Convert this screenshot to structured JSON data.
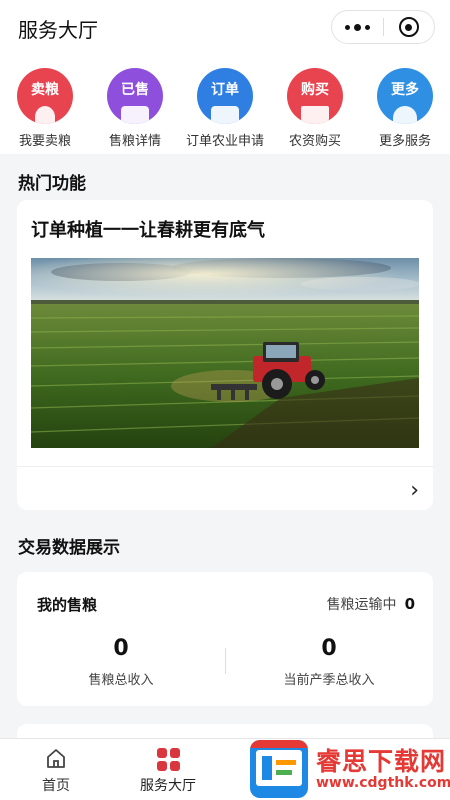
{
  "header": {
    "title": "服务大厅"
  },
  "quick": [
    {
      "word": "卖粮",
      "label": "我要卖粮",
      "color": "#e8444f",
      "icon": "sell-grain-icon"
    },
    {
      "word": "已售",
      "label": "售粮详情",
      "color": "#8e4fdc",
      "icon": "sold-detail-icon"
    },
    {
      "word": "订单",
      "label": "订单农业申请",
      "color": "#2f7fe3",
      "icon": "order-apply-icon"
    },
    {
      "word": "购买",
      "label": "农资购买",
      "color": "#e8444f",
      "icon": "purchase-icon"
    },
    {
      "word": "更多",
      "label": "更多服务",
      "color": "#2f8fe3",
      "icon": "more-services-icon"
    }
  ],
  "hot": {
    "section_title": "热门功能",
    "card_title": "订单种植一一让春耕更有底气"
  },
  "stats": {
    "section_title": "交易数据展示",
    "title": "我的售粮",
    "transport_label": "售粮运输中",
    "transport_value": "0",
    "income_value": "0",
    "income_label": "售粮总收入",
    "season_value": "0",
    "season_label": "当前产季总收入"
  },
  "tabs": [
    {
      "label": "首页"
    },
    {
      "label": "服务大厅"
    }
  ],
  "watermark": {
    "name": "睿思下载网",
    "url": "www.cdgthk.com"
  }
}
